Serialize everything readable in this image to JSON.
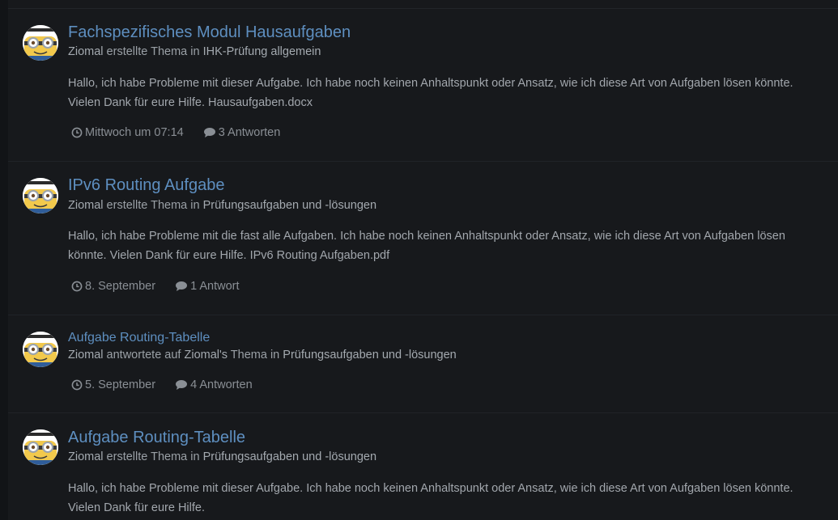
{
  "items": [
    {
      "title": "Fachspezifisches Modul Hausaufgaben",
      "author": "Ziomal",
      "action": "erstellte Thema in",
      "forum": "IHK-Prüfung allgemein",
      "snippet": "Hallo, ich habe Probleme mit dieser Aufgabe. Ich habe noch keinen Anhaltspunkt oder Ansatz, wie ich diese Art von Aufgaben lösen könnte. Vielen Dank für eure Hilfe. Hausaufgaben.docx",
      "time": "Mittwoch um 07:14",
      "replies": "3 Antworten",
      "clock_icon": "clock-icon",
      "comment_icon": "comment-icon"
    },
    {
      "title": "IPv6 Routing Aufgabe",
      "author": "Ziomal",
      "action": "erstellte Thema in",
      "forum": "Prüfungsaufgaben und -lösungen",
      "snippet": "Hallo, ich habe Probleme mit die fast alle Aufgaben. Ich habe noch keinen Anhaltspunkt oder Ansatz, wie ich diese Art von Aufgaben lösen könnte. Vielen Dank für eure Hilfe. IPv6 Routing Aufgaben.pdf",
      "time": "8. September",
      "replies": "1 Antwort",
      "clock_icon": "clock-icon",
      "comment_icon": "comment-icon"
    },
    {
      "title": "Aufgabe Routing-Tabelle",
      "author": "Ziomal",
      "action": "antwortete auf",
      "topic_owner": "Ziomal's",
      "action2": "Thema in",
      "forum": "Prüfungsaufgaben und -lösungen",
      "time": "5. September",
      "replies": "4 Antworten",
      "clock_icon": "clock-icon",
      "comment_icon": "comment-icon"
    },
    {
      "title": "Aufgabe Routing-Tabelle",
      "author": "Ziomal",
      "action": "erstellte Thema in",
      "forum": "Prüfungsaufgaben und -lösungen",
      "snippet": "Hallo, ich habe Probleme mit dieser Aufgabe. Ich habe noch keinen Anhaltspunkt oder Ansatz, wie ich diese Art von Aufgaben lösen könnte. Vielen Dank für eure Hilfe."
    }
  ],
  "colors": {
    "background": "#121417",
    "panel": "#17191c",
    "link": "#5e8fc0",
    "text": "#a2a7ad",
    "muted": "#8a8f95"
  }
}
